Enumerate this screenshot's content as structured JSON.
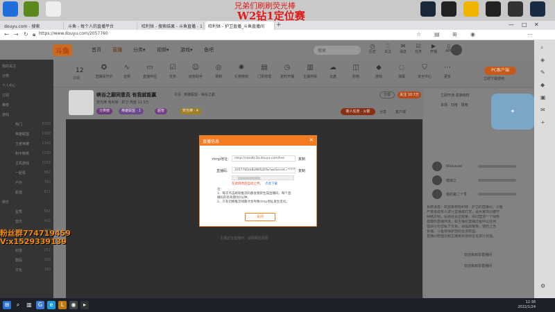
{
  "overlay": {
    "title_line1": "兄弟们刷刷荧光棒",
    "title_line2": "W2钻1定位赛",
    "watermark_1": "粉丝群774719459",
    "watermark_2": "V:x1529339139"
  },
  "browser": {
    "tabs": [
      {
        "label": "douyu.com - 搜索"
      },
      {
        "label": "斗鱼 - 每个人的直播平台"
      },
      {
        "label": "哈利钵 - 搜索结果 - 斗鱼直播 - 1"
      },
      {
        "label": "哈利钵 - 护卫直播_斗鱼直播间"
      }
    ],
    "url": "https://www.douyu.com/2057760"
  },
  "topnav": {
    "logo": "斗鱼",
    "items": [
      "首页",
      "直播",
      "分类▾",
      "视频▾",
      "游戏▾",
      "鱼吧"
    ],
    "search_placeholder": "搜索",
    "icons": [
      {
        "icon": "history-icon",
        "label": "历史"
      },
      {
        "icon": "follow-icon",
        "label": "关注"
      },
      {
        "icon": "message-icon",
        "label": "消息"
      },
      {
        "icon": "task-icon",
        "label": "任务"
      },
      {
        "icon": "live-icon",
        "label": "开播"
      },
      {
        "icon": "app-icon",
        "label": "APP"
      }
    ]
  },
  "toolbar": {
    "sub_count": "12",
    "sub_count_label": "订阅",
    "tools": [
      {
        "icon": "badge-icon",
        "label": "直播间守护"
      },
      {
        "icon": "wave-icon",
        "label": "音频"
      },
      {
        "icon": "screen-icon",
        "label": "直播伴侣"
      },
      {
        "icon": "task-icon",
        "label": "任务"
      },
      {
        "icon": "bot-icon",
        "label": "房管助手"
      },
      {
        "icon": "camera-icon",
        "label": "录制"
      },
      {
        "icon": "fx-icon",
        "label": "礼物特效"
      },
      {
        "icon": "ticket-icon",
        "label": "门票管理"
      },
      {
        "icon": "clock-icon",
        "label": "定时开播"
      },
      {
        "icon": "book-icon",
        "label": "主播学院"
      },
      {
        "icon": "cloud-icon",
        "label": "云盘"
      },
      {
        "icon": "cart-icon",
        "label": "购物"
      },
      {
        "icon": "game-icon",
        "label": "游戏"
      },
      {
        "icon": "chat-icon",
        "label": "弹幕"
      },
      {
        "icon": "shield-icon",
        "label": "安全中心"
      },
      {
        "icon": "more-icon",
        "label": "更多"
      }
    ],
    "pc_client": "PC客户端",
    "pc_client_sub": "立即下载使用"
  },
  "sidebar": {
    "rows": [
      {
        "a": "我的关注",
        "b": "",
        "c": ""
      },
      {
        "a": "分类",
        "b": "",
        "c": ""
      },
      {
        "a": "个人中心",
        "b": "",
        "c": ""
      },
      {
        "a": "订阅",
        "b": "",
        "c": ""
      },
      {
        "a": "推荐",
        "b": "",
        "c": ""
      },
      {
        "a": "游戏",
        "b": "",
        "c": ""
      },
      {
        "a": "",
        "b": "热门",
        "c": "2020"
      },
      {
        "a": "",
        "b": "英雄联盟",
        "c": "1999"
      },
      {
        "a": "",
        "b": "王者荣耀",
        "c": "1340"
      },
      {
        "a": "",
        "b": "和平精英",
        "c": "1290"
      },
      {
        "a": "",
        "b": "主机游戏",
        "c": "1003"
      },
      {
        "a": "",
        "b": "一起看",
        "c": "882"
      },
      {
        "a": "",
        "b": "户外",
        "c": "760"
      },
      {
        "a": "",
        "b": "颜值",
        "c": "611"
      },
      {
        "a": "娱乐",
        "b": "",
        "c": ""
      },
      {
        "a": "",
        "b": "星秀",
        "c": "561"
      },
      {
        "a": "",
        "b": "音乐",
        "c": "402"
      },
      {
        "a": "",
        "b": "舞蹈",
        "c": "377"
      },
      {
        "a": "",
        "b": "二次元",
        "c": "300"
      },
      {
        "a": "",
        "b": "科技",
        "c": "251"
      },
      {
        "a": "",
        "b": "数码",
        "c": "200"
      },
      {
        "a": "",
        "b": "文化",
        "c": "180"
      }
    ]
  },
  "room": {
    "title": "峡谷之巅同意员 有我就能赢",
    "report": "举报",
    "category": "英雄联盟 · 峡谷之巅",
    "meta": "荧光棒 哈利钵 · 护卫    热度 11.5万",
    "badges": [
      "分类榜",
      "英雄联盟 · 1",
      "超管",
      "荧光棒 · 4"
    ],
    "share": "分享",
    "follow": "关注 10.7万",
    "newbie": "新人任务 · 火箭",
    "share_link": "分享",
    "client_link": "客户端"
  },
  "player": {
    "tip": "主播正在直播中，请刷新后观看"
  },
  "dialog": {
    "title": "直播信息",
    "rtmp_label": "rtmp地址:",
    "rtmp_value": "rtmp://sendtc3a.douyu.com/live",
    "code_label": "直播码:",
    "code_value": "2057760rkBUWRzDTw?wsSecret=************",
    "copy_label": "复制",
    "warn": "在此修改后自动上传。",
    "warn_link": "点此下载",
    "note_lines": [
      "注:",
      "1、每次点击刷新推流码都会重新生成直播码，每个直",
      "   播码的有效期为5分钟。",
      "2、只有切换推流线路才会导致rtmp地址发生变化。"
    ],
    "close_btn": "关闭"
  },
  "chat": {
    "head_lines": [
      "立即开通  贵族特权",
      "本场 · 日榜 · 周榜"
    ],
    "ranks": [
      {
        "name": "Wxxuuxe"
      },
      {
        "name": "暗夜之"
      },
      {
        "name": "我的第二个号"
      }
    ],
    "notice_lines": [
      "系统消息：欢迎来到哈利钵 · 护卫的直播间，斗鱼",
      "严禁未成年人进行直播或打赏，请大家共同遵守",
      "网络文明，弘扬社会正能量，共同营造一个绿色",
      "健康的直播环境。如主播在直播过程中以任何",
      "理由引导您私下交易，请提高警惕，谨防上当",
      "受骗。斗鱼将保护您的合法权益。",
      "直播间管理员和主播将对违规言论进行处理。"
    ],
    "msg1": "欢迎来到本直播间",
    "msg2": "欢迎来到本直播间"
  },
  "taskbar": {
    "time": "12:38",
    "date": "2022/1/24"
  }
}
